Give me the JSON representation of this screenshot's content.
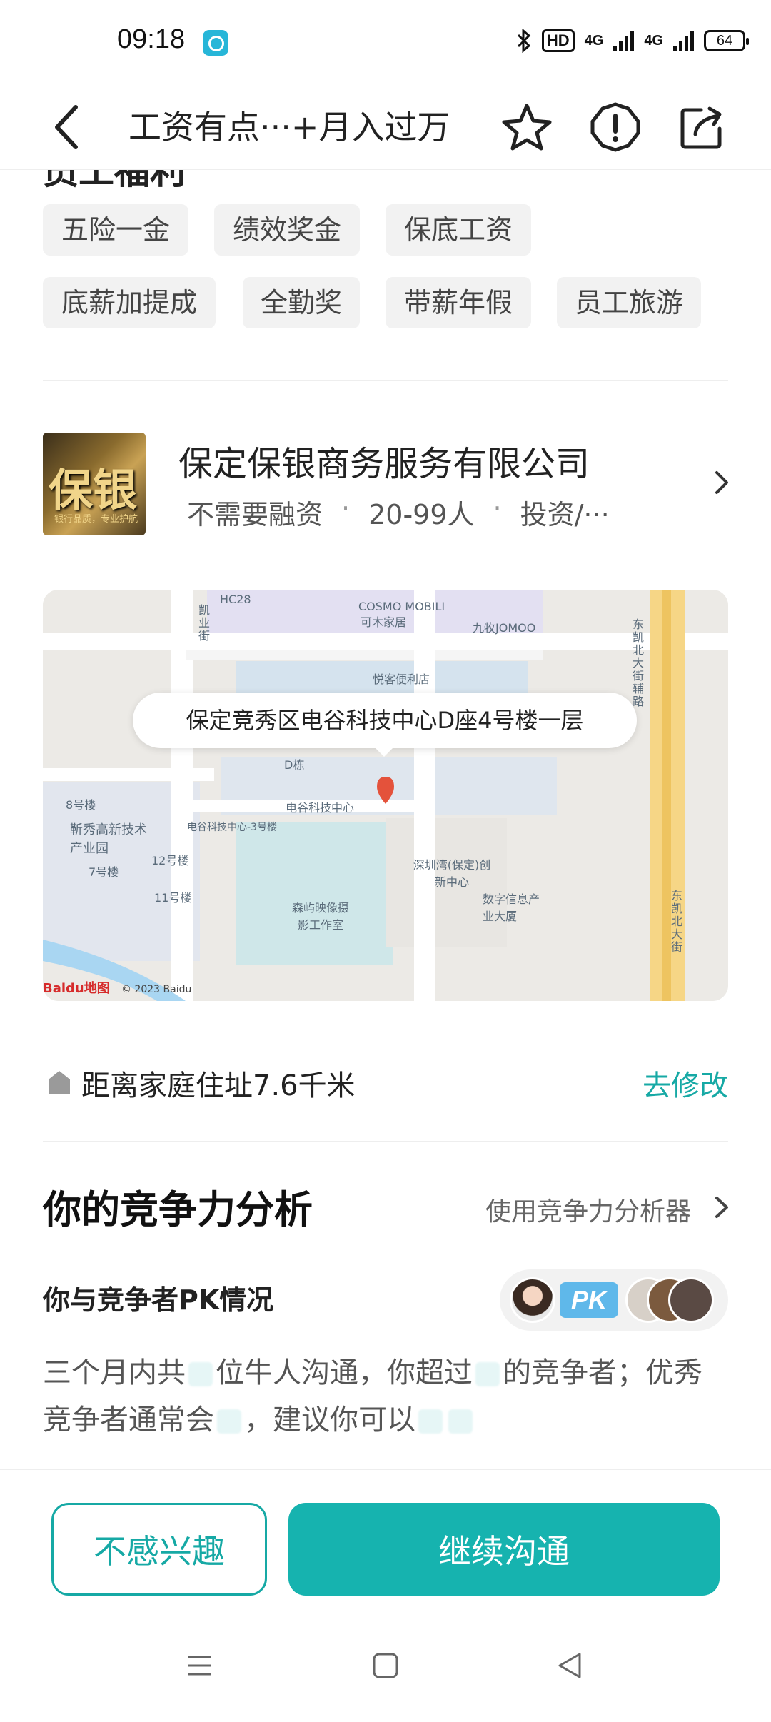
{
  "status_bar": {
    "time": "09:18",
    "hd_label": "HD",
    "network_1": "4G",
    "network_2": "4G",
    "battery": "64"
  },
  "header": {
    "title": "工资有点···+月入过万",
    "icons": [
      "back-icon",
      "star-icon",
      "warning-icon",
      "share-icon"
    ]
  },
  "benefits": {
    "section_title": "员工福利",
    "tags": [
      "五险一金",
      "绩效奖金",
      "保底工资",
      "底薪加提成",
      "全勤奖",
      "带薪年假",
      "员工旅游"
    ]
  },
  "company": {
    "logo_text": "保银",
    "logo_subtext": "银行品质，专业护航",
    "name": "保定保银商务服务有限公司",
    "financing": "不需要融资",
    "size": "20-99人",
    "industry": "投资/···",
    "separator": "·"
  },
  "map": {
    "address": "保定竞秀区电谷科技中心D座4号楼一层",
    "labels": [
      "HC28",
      "COSMO MOBILI",
      "可木家居",
      "九牧JOMOO",
      "凯业街",
      "悦客便利店",
      "东凯北大街辅路",
      "D栋",
      "8号楼",
      "电谷科技中心",
      "电谷科技中心-3号楼",
      "靳秀高新技术产业园",
      "12号楼",
      "7号楼",
      "11号楼",
      "深圳湾(保定)创新中心",
      "数字信息产业大厦",
      "森屿映像摄影工作室",
      "东凯北大街"
    ],
    "provider": "Baidu地图",
    "copyright": "© 2023 Baidu"
  },
  "distance": {
    "text": "距离家庭住址7.6千米",
    "edit_label": "去修改"
  },
  "competitiveness": {
    "title": "你的竞争力分析",
    "tool_link": "使用竞争力分析器",
    "pk_label": "你与竞争者PK情况",
    "pk_badge": "PK",
    "desc_part1": "三个月内共",
    "desc_part2": "位牛人沟通，你超过",
    "desc_part3": "的竞争者；优秀竞争者通常会",
    "desc_part4": "，建议你可以"
  },
  "actions": {
    "decline": "不感兴趣",
    "continue": "继续沟通"
  },
  "colors": {
    "accent": "#16a9a5",
    "button_primary": "#16b3af",
    "tag_bg": "#f2f2f2"
  }
}
